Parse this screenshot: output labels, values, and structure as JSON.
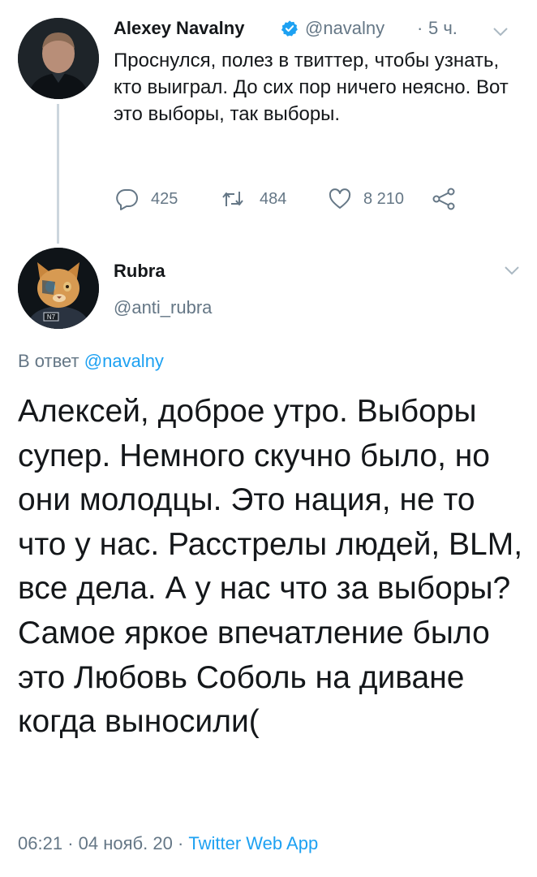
{
  "tweet1": {
    "author_name": "Alexey Navalny",
    "handle": "@navalny",
    "separator": "·",
    "time": "5 ч.",
    "text": "Проснулся, полез в твиттер, чтобы узнать, кто выиграл. До сих пор ничего неясно. Вот это выборы, так выборы.",
    "replies": "425",
    "retweets": "484",
    "likes": "8 210"
  },
  "tweet2": {
    "author_name": "Rubra",
    "handle": "@anti_rubra",
    "reply_to_prefix": "В ответ",
    "reply_to_mention": "@navalny",
    "text": "Алексей, доброе утро. Выборы супер. Немного скучно было, но они молодцы. Это нация, не то что у нас. Расстрелы людей, BLM, все дела. А у нас что за выборы? Самое яркое впечатление было это Любовь Соболь на диване когда выносили(",
    "time": "06:21",
    "date": "04 нояб. 20",
    "source": "Twitter Web App",
    "separator": "·",
    "avatar_badge": "N7"
  },
  "colors": {
    "text_primary": "#14171a",
    "text_secondary": "#657786",
    "accent": "#1da1f2",
    "thread_line": "#ccd6dd"
  },
  "icons": [
    "verified-badge-icon",
    "chevron-down-icon",
    "reply-icon",
    "retweet-icon",
    "like-icon",
    "share-icon"
  ]
}
